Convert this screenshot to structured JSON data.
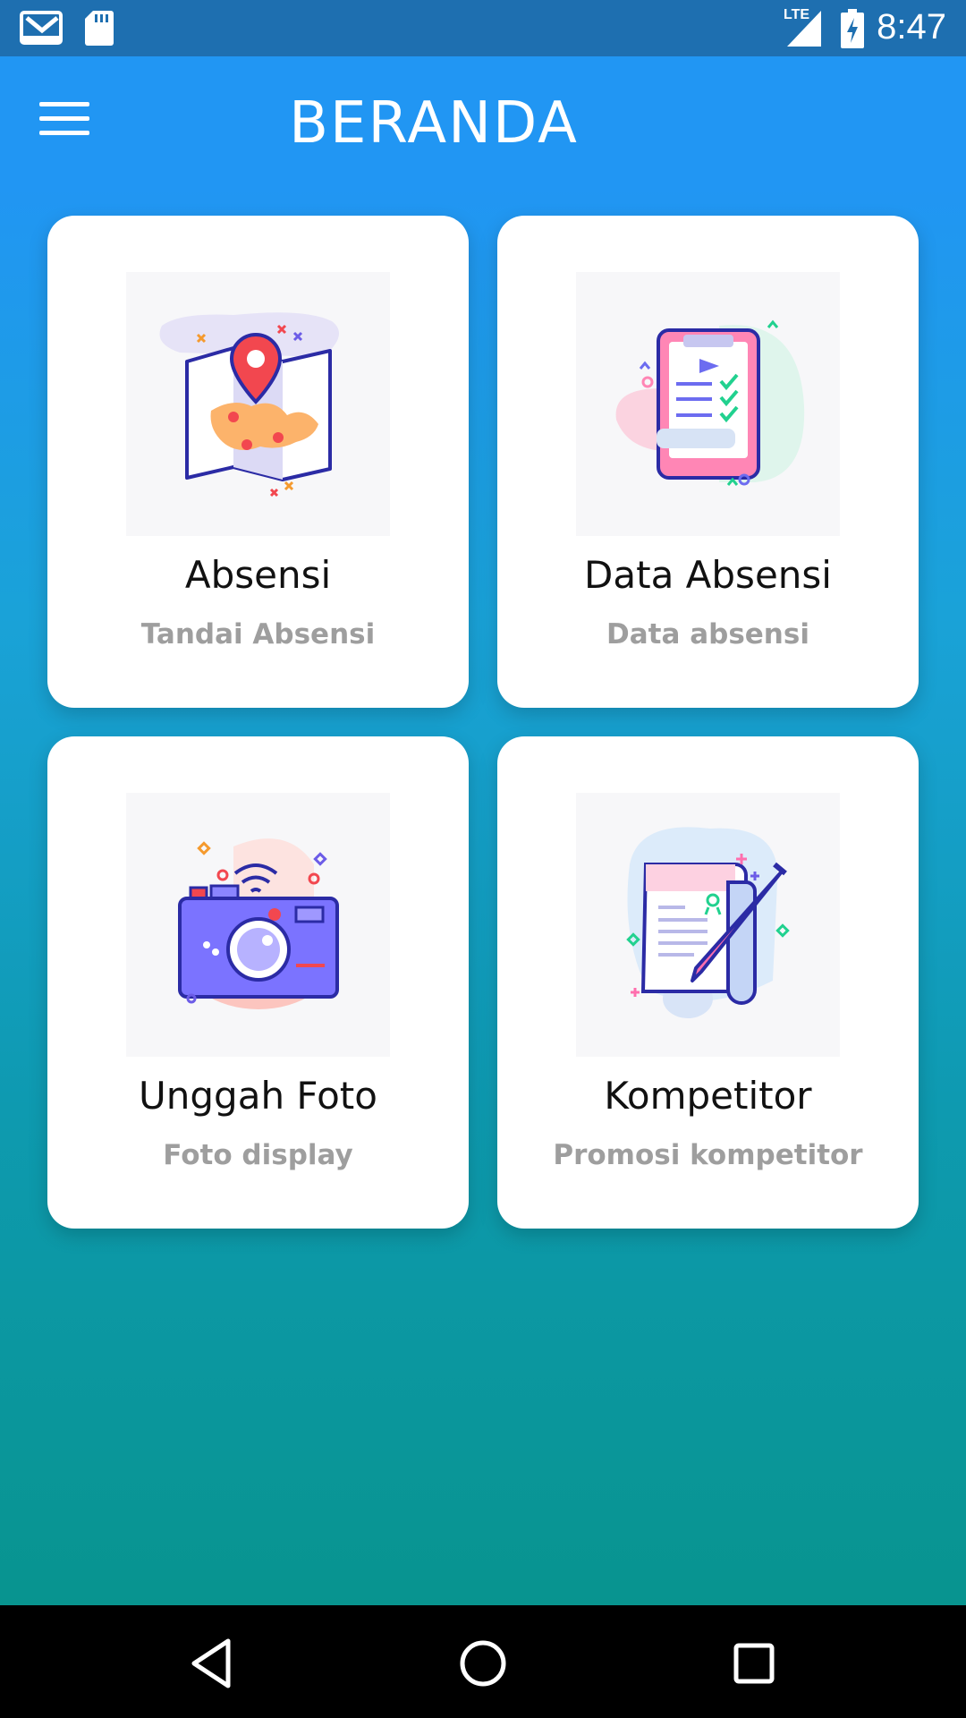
{
  "status_bar": {
    "time": "8:47",
    "network_label": "LTE",
    "icons": [
      "gmail-icon",
      "sd-card-icon",
      "lte-signal-icon",
      "battery-charging-icon"
    ]
  },
  "app_bar": {
    "title": "BERANDA",
    "menu_icon": "hamburger-menu-icon",
    "color": "#2196f3"
  },
  "menu": {
    "items": [
      {
        "title": "Absensi",
        "subtitle": "Tandai Absensi",
        "icon": "map-location-icon"
      },
      {
        "title": "Data Absensi",
        "subtitle": "Data absensi",
        "icon": "checklist-tablet-icon"
      },
      {
        "title": "Unggah Foto",
        "subtitle": "Foto display",
        "icon": "camera-icon"
      },
      {
        "title": "Kompetitor",
        "subtitle": "Promosi kompetitor",
        "icon": "document-pen-icon"
      }
    ]
  },
  "nav_bar": {
    "buttons": [
      "back-icon",
      "home-icon",
      "recents-icon"
    ]
  },
  "colors": {
    "gradient_top": "#2196f3",
    "gradient_bottom": "#08948f",
    "card": "#ffffff",
    "subtitle": "#9e9e9e"
  }
}
